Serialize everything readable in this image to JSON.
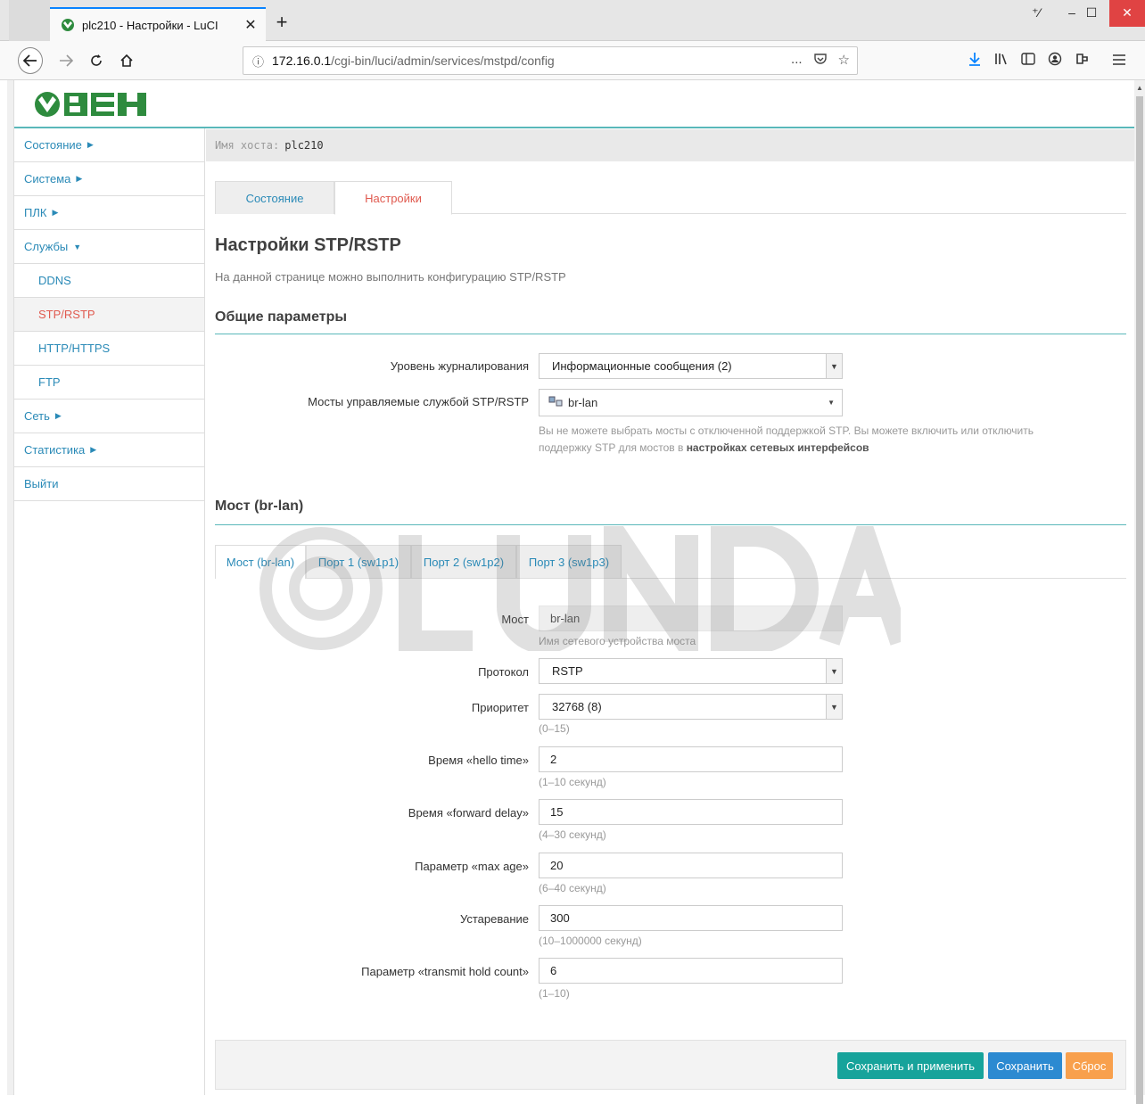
{
  "browser": {
    "tab_title": "plc210 - Настройки - LuCI",
    "url_host": "172.16.0.1",
    "url_path": "/cgi-bin/luci/admin/services/mstpd/config",
    "page_actions_icon": "...",
    "toolbar_icons": [
      "download-icon",
      "library-icon",
      "sidebar-icon",
      "account-icon",
      "extension-icon",
      "menu-icon"
    ]
  },
  "logo": {
    "text": "ОВЕН",
    "brand_color": "#2e8b3e"
  },
  "hostbar": {
    "label": "Имя хоста:",
    "value": "plc210"
  },
  "sidebar": {
    "items": [
      {
        "label": "Состояние"
      },
      {
        "label": "Система"
      },
      {
        "label": "ПЛК"
      },
      {
        "label": "Службы"
      },
      {
        "label": "DDNS"
      },
      {
        "label": "STP/RSTP"
      },
      {
        "label": "HTTP/HTTPS"
      },
      {
        "label": "FTP"
      },
      {
        "label": "Сеть"
      },
      {
        "label": "Статистика"
      },
      {
        "label": "Выйти"
      }
    ]
  },
  "tabs": {
    "status": "Состояние",
    "settings": "Настройки"
  },
  "heading": "Настройки STP/RSTP",
  "description": "На данной странице можно выполнить конфигурацию STP/RSTP",
  "general": {
    "title": "Общие параметры",
    "log_level": {
      "label": "Уровень журналирования",
      "value": "Информационные сообщения (2)"
    },
    "bridges": {
      "label": "Мосты управляемые службой STP/RSTP",
      "value": "br-lan",
      "help_1": "Вы не можете выбрать мосты с отключенной поддержкой STP. Вы можете включить или отключить",
      "help_2": "поддержку STP для мостов в ",
      "help_link": "настройках сетевых интерфейсов"
    }
  },
  "bridge_section": {
    "title": "Мост (br-lan)",
    "subtabs": [
      "Мост (br-lan)",
      "Порт 1 (sw1p1)",
      "Порт 2 (sw1p2)",
      "Порт 3 (sw1p3)"
    ],
    "fields": {
      "bridge": {
        "label": "Мост",
        "value": "br-lan",
        "help": "Имя сетевого устройства моста"
      },
      "protocol": {
        "label": "Протокол",
        "value": "RSTP"
      },
      "priority": {
        "label": "Приоритет",
        "value": "32768 (8)",
        "help": "(0–15)"
      },
      "hello": {
        "label": "Время «hello time»",
        "value": "2",
        "help": "(1–10 секунд)"
      },
      "forward": {
        "label": "Время «forward delay»",
        "value": "15",
        "help": "(4–30 секунд)"
      },
      "maxage": {
        "label": "Параметр «max age»",
        "value": "20",
        "help": "(6–40 секунд)"
      },
      "ageing": {
        "label": "Устаревание",
        "value": "300",
        "help": "(10–1000000 секунд)"
      },
      "txhold": {
        "label": "Параметр «transmit hold count»",
        "value": "6",
        "help": "(1–10)"
      }
    }
  },
  "buttons": {
    "apply": "Сохранить и применить",
    "save": "Сохранить",
    "reset": "Сброс"
  },
  "colors": {
    "accent": "#5ab8ba",
    "link": "#2a8ab7",
    "active": "#e05a4f"
  }
}
